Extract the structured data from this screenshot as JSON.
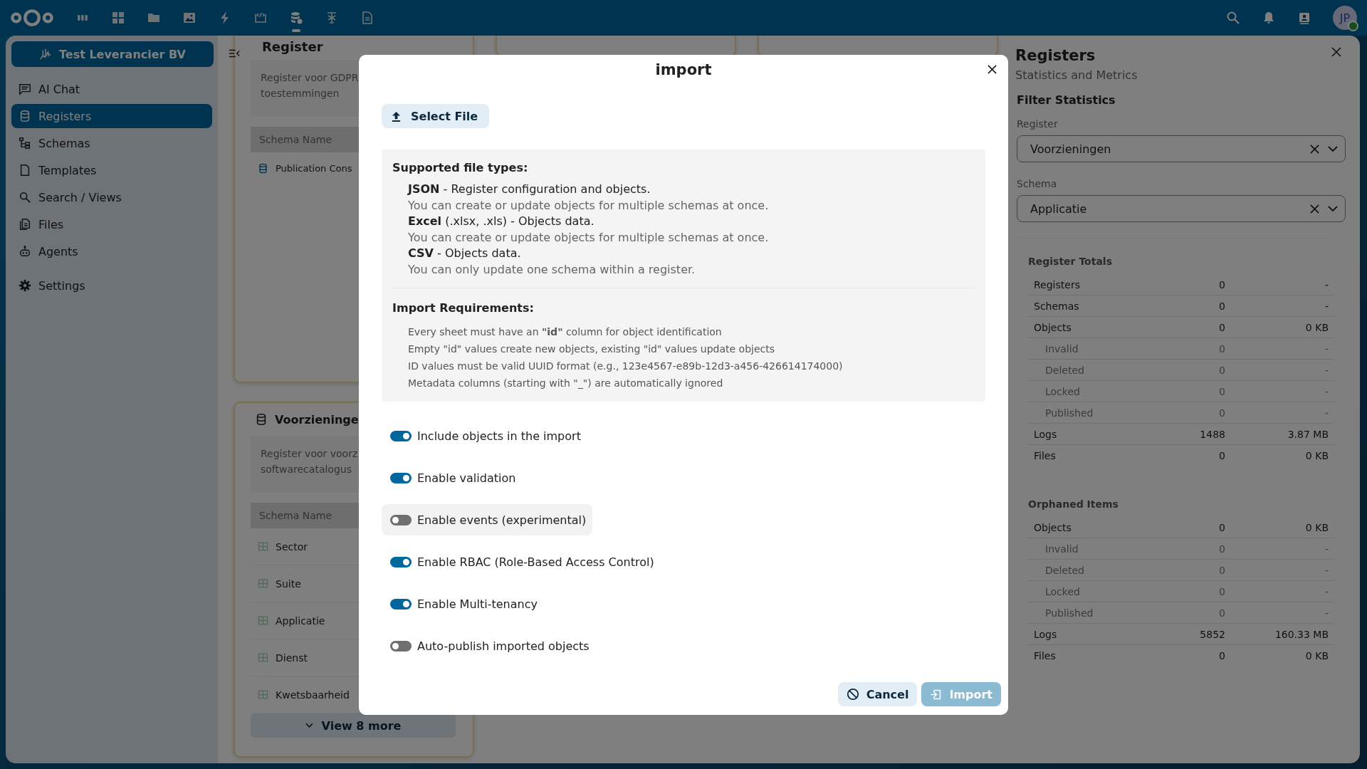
{
  "topbar": {
    "apps": [
      {
        "kind": "columns",
        "selected": false
      },
      {
        "kind": "grid",
        "selected": false
      },
      {
        "kind": "folder",
        "selected": false
      },
      {
        "kind": "image",
        "selected": false
      },
      {
        "kind": "bolt",
        "selected": false
      },
      {
        "kind": "code",
        "selected": false
      },
      {
        "kind": "database",
        "selected": true
      },
      {
        "kind": "tool",
        "selected": false
      },
      {
        "kind": "file",
        "selected": false
      }
    ],
    "avatar": {
      "initials": "JP",
      "online": true
    }
  },
  "sidebar": {
    "org_button": "Test Leverancier BV",
    "items": [
      {
        "kind": "chat",
        "label": "AI Chat",
        "selected": false
      },
      {
        "kind": "database",
        "label": "Registers",
        "selected": true
      },
      {
        "kind": "schema",
        "label": "Schemas",
        "selected": false
      },
      {
        "kind": "file",
        "label": "Templates",
        "selected": false
      },
      {
        "kind": "search",
        "label": "Search / Views",
        "selected": false
      },
      {
        "kind": "files",
        "label": "Files",
        "selected": false
      },
      {
        "kind": "robot",
        "label": "Agents",
        "selected": false
      }
    ],
    "settings": "Settings"
  },
  "cards": [
    {
      "title": "Register",
      "description": "Register voor GDPR toestemmingen",
      "column_header": "Schema Name",
      "rows": [
        {
          "kind": "database",
          "name": "Publication Cons"
        }
      ]
    },
    {
      "title": "Voorzieninge",
      "description": "Register voor voorz softwarecatalogus",
      "column_header": "Schema Name",
      "rows": [
        {
          "kind": "table",
          "name": "Sector"
        },
        {
          "kind": "table",
          "name": "Suite"
        },
        {
          "kind": "table",
          "name": "Applicatie"
        },
        {
          "kind": "table",
          "name": "Dienst"
        },
        {
          "kind": "table",
          "name": "Kwetsbaarheid"
        }
      ],
      "more_button": "View 8 more"
    }
  ],
  "modal": {
    "title": "import",
    "select_file": "Select File",
    "supported": {
      "heading": "Supported file types:",
      "items": [
        {
          "text": "**JSON** - Register configuration and objects.",
          "note": "You can create or update objects for multiple schemas at once."
        },
        {
          "text": "**Excel** (.xlsx, .xls) - Objects data.",
          "note": "You can create or update objects for multiple schemas at once."
        },
        {
          "text": "**CSV** - Objects data.",
          "note": "You can only update one schema within a register."
        }
      ]
    },
    "requirements": {
      "heading": "Import Requirements:",
      "items": [
        "Every sheet must have an **\"id\"** column for object identification",
        "Empty \"id\" values create new objects, existing \"id\" values update objects",
        "ID values must be valid UUID format (e.g., 123e4567-e89b-12d3-a456-426614174000)",
        "Metadata columns (starting with \"_\") are automatically ignored"
      ]
    },
    "toggles": [
      {
        "label": "Include objects in the import",
        "on": true,
        "hovered": false
      },
      {
        "label": "Enable validation",
        "on": true,
        "hovered": false
      },
      {
        "label": "Enable events (experimental)",
        "on": false,
        "hovered": true
      },
      {
        "label": "Enable RBAC (Role-Based Access Control)",
        "on": true,
        "hovered": false
      },
      {
        "label": "Enable Multi-tenancy",
        "on": true,
        "hovered": false
      },
      {
        "label": "Auto-publish imported objects",
        "on": false,
        "hovered": false
      }
    ],
    "buttons": [
      {
        "kind": "cancel",
        "label": "Cancel",
        "disabled": false
      },
      {
        "kind": "import",
        "label": "Import",
        "disabled": true
      }
    ]
  },
  "right_panel": {
    "title": "Registers",
    "subtitle": "Statistics and Metrics",
    "filter_heading": "Filter Statistics",
    "filters": [
      {
        "label": "Register",
        "value": "Voorzieningen"
      },
      {
        "label": "Schema",
        "value": "Applicatie"
      }
    ],
    "sections": [
      {
        "title": "Register Totals",
        "rows": [
          {
            "kind": "main",
            "label": "Registers",
            "count": "0",
            "size": "-"
          },
          {
            "kind": "main",
            "label": "Schemas",
            "count": "0",
            "size": "-"
          },
          {
            "kind": "main",
            "label": "Objects",
            "count": "0",
            "size": "0 KB"
          },
          {
            "kind": "sub",
            "label": "Invalid",
            "count": "0",
            "size": "-"
          },
          {
            "kind": "sub",
            "label": "Deleted",
            "count": "0",
            "size": "-"
          },
          {
            "kind": "sub",
            "label": "Locked",
            "count": "0",
            "size": "-"
          },
          {
            "kind": "sub",
            "label": "Published",
            "count": "0",
            "size": "-"
          },
          {
            "kind": "main",
            "label": "Logs",
            "count": "1488",
            "size": "3.87 MB"
          },
          {
            "kind": "main",
            "label": "Files",
            "count": "0",
            "size": "0 KB"
          }
        ]
      },
      {
        "title": "Orphaned Items",
        "rows": [
          {
            "kind": "main",
            "label": "Objects",
            "count": "0",
            "size": "0 KB"
          },
          {
            "kind": "sub",
            "label": "Invalid",
            "count": "0",
            "size": "-"
          },
          {
            "kind": "sub",
            "label": "Deleted",
            "count": "0",
            "size": "-"
          },
          {
            "kind": "sub",
            "label": "Locked",
            "count": "0",
            "size": "-"
          },
          {
            "kind": "sub",
            "label": "Published",
            "count": "0",
            "size": "-"
          },
          {
            "kind": "main",
            "label": "Logs",
            "count": "5852",
            "size": "160.33 MB"
          },
          {
            "kind": "main",
            "label": "Files",
            "count": "0",
            "size": "0 KB"
          }
        ]
      }
    ]
  }
}
